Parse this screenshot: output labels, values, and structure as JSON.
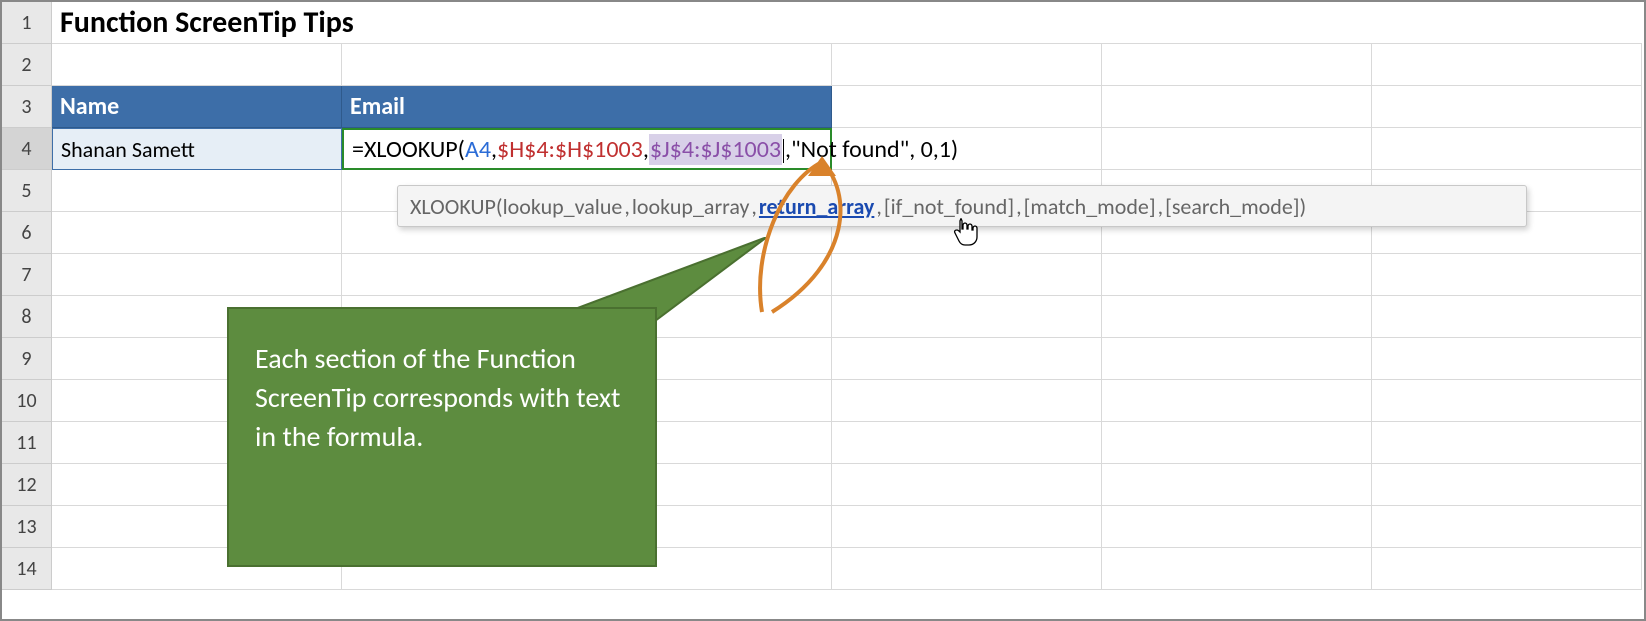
{
  "rows": [
    "1",
    "2",
    "3",
    "4",
    "5",
    "6",
    "7",
    "8",
    "9",
    "10",
    "11",
    "12",
    "13",
    "14"
  ],
  "title": "Function ScreenTip Tips",
  "headers": {
    "name": "Name",
    "email": "Email"
  },
  "row4": {
    "name": "Shanan Samett"
  },
  "formula": {
    "prefix": "=XLOOKUP(",
    "arg1": "A4",
    "sep": ",",
    "arg2": "$H$4:$H$1003",
    "arg3": "$J$4:$J$1003",
    "suffix": ",\"Not found\", 0,1)"
  },
  "tooltip": {
    "fn": "XLOOKUP",
    "open": "(",
    "a1": "lookup_value",
    "a2": "lookup_array",
    "a3": "return_array",
    "a4": "[if_not_found]",
    "a5": "[match_mode]",
    "a6": "[search_mode]",
    "close": ")",
    "sep": ", "
  },
  "callout": "Each section of the Function ScreenTip corresponds with text in the formula."
}
